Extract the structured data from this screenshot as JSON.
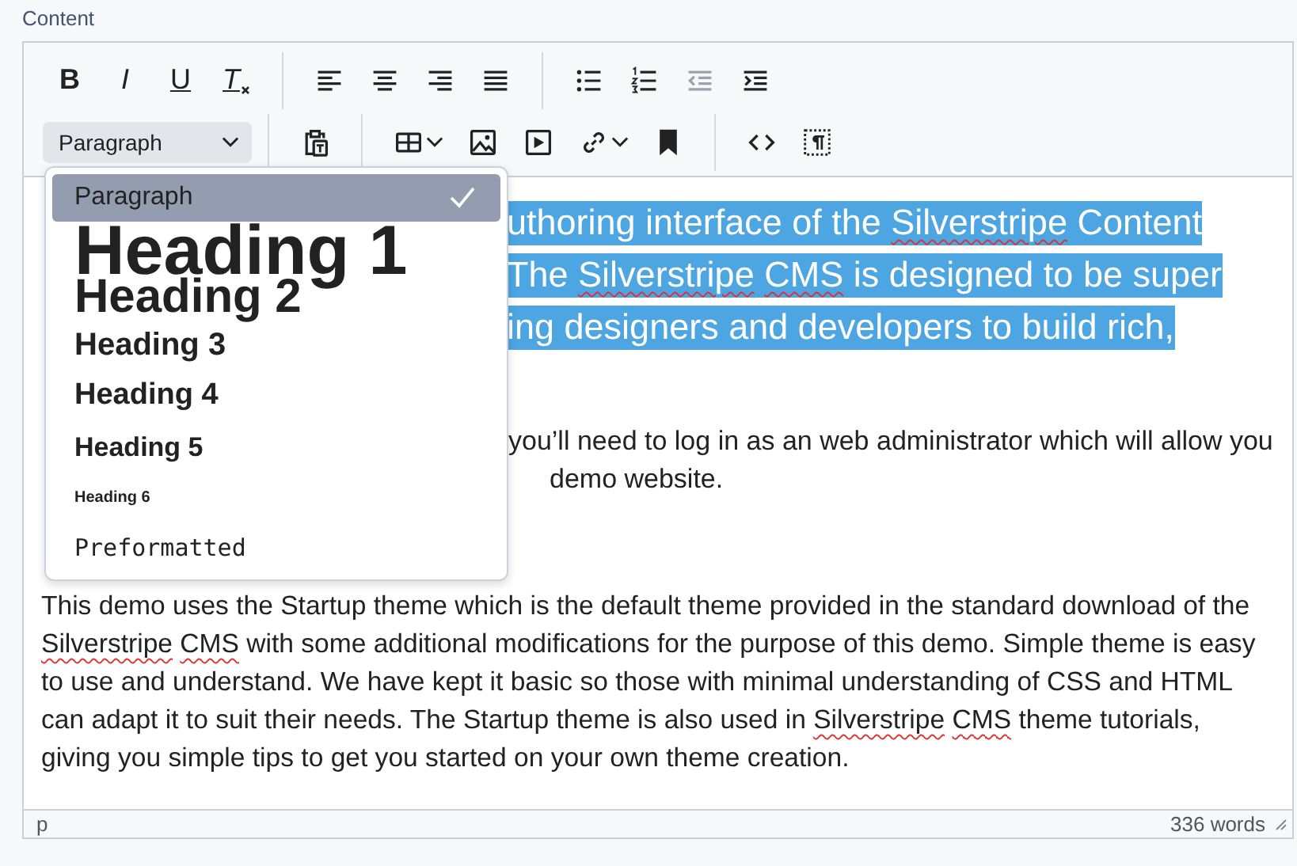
{
  "field_label": "Content",
  "toolbar": {
    "rows": [
      [
        {
          "buttons": [
            {
              "kind": "bold",
              "glyph": "B",
              "disabled": false,
              "has_menu": false
            },
            {
              "kind": "italic",
              "glyph": "I",
              "disabled": false,
              "has_menu": false
            },
            {
              "kind": "underline",
              "glyph": "U",
              "disabled": false,
              "has_menu": false
            },
            {
              "kind": "clear-format",
              "glyph": "T",
              "disabled": false,
              "has_menu": false
            }
          ]
        },
        {
          "buttons": [
            {
              "kind": "align-left",
              "disabled": false,
              "has_menu": false
            },
            {
              "kind": "align-center",
              "disabled": false,
              "has_menu": false
            },
            {
              "kind": "align-right",
              "disabled": false,
              "has_menu": false
            },
            {
              "kind": "align-justify",
              "disabled": false,
              "has_menu": false
            }
          ]
        },
        {
          "buttons": [
            {
              "kind": "bullet-list",
              "disabled": false,
              "has_menu": false
            },
            {
              "kind": "number-list",
              "disabled": false,
              "has_menu": false
            },
            {
              "kind": "outdent",
              "disabled": true,
              "has_menu": false
            },
            {
              "kind": "indent",
              "disabled": false,
              "has_menu": false
            }
          ]
        }
      ],
      [
        {
          "select": {
            "value": "Paragraph",
            "expanded": true
          }
        },
        {
          "buttons": [
            {
              "kind": "paste-text",
              "disabled": false,
              "has_menu": false
            }
          ]
        },
        {
          "buttons": [
            {
              "kind": "table",
              "disabled": false,
              "has_menu": true
            },
            {
              "kind": "image",
              "disabled": false,
              "has_menu": false
            },
            {
              "kind": "media",
              "disabled": false,
              "has_menu": false
            },
            {
              "kind": "link",
              "disabled": false,
              "has_menu": true
            },
            {
              "kind": "bookmark",
              "disabled": false,
              "has_menu": false
            }
          ]
        },
        {
          "buttons": [
            {
              "kind": "code",
              "disabled": false,
              "has_menu": false
            },
            {
              "kind": "visual-blocks",
              "disabled": false,
              "has_menu": false
            }
          ]
        }
      ]
    ]
  },
  "format_menu": [
    {
      "label": "Paragraph",
      "kind": "p",
      "selected": true
    },
    {
      "label": "Heading 1",
      "kind": "h1",
      "selected": false
    },
    {
      "label": "Heading 2",
      "kind": "h2",
      "selected": false
    },
    {
      "label": "Heading 3",
      "kind": "h3",
      "selected": false
    },
    {
      "label": "Heading 4",
      "kind": "h4",
      "selected": false
    },
    {
      "label": "Heading 5",
      "kind": "h5",
      "selected": false
    },
    {
      "label": "Heading 6",
      "kind": "h6",
      "selected": false
    },
    {
      "label": "Preformatted",
      "kind": "pre",
      "selected": false
    }
  ],
  "content": {
    "lead": {
      "selected": true,
      "lines": [
        [
          {
            "text": "uthoring interface of the ",
            "misspelled": false
          },
          {
            "text": "Silverstripe",
            "misspelled": true
          },
          {
            "text": " Content",
            "misspelled": false
          }
        ],
        [
          {
            "text": "The ",
            "misspelled": false
          },
          {
            "text": "Silverstripe ",
            "misspelled": true
          },
          {
            "text": "CMS",
            "misspelled": true
          },
          {
            "text": " is designed to be super",
            "misspelled": false
          }
        ],
        [
          {
            "text": "ing designers and developers to build rich,",
            "misspelled": false
          }
        ]
      ]
    },
    "intro_lines": [
      "you’ll need to log in as an web administrator which will allow you",
      "demo website."
    ],
    "body": [
      {
        "text": "This demo uses the Startup theme which is the default theme provided in the standard download of the ",
        "misspelled": false
      },
      {
        "text": "Silverstripe ",
        "misspelled": true
      },
      {
        "text": "CMS",
        "misspelled": true
      },
      {
        "text": " with some additional modifications for the purpose of this demo. Simple theme is easy to use and understand. We have kept it basic so those with minimal understanding of CSS and HTML can adapt it to suit their needs. The Startup theme is also used in ",
        "misspelled": false
      },
      {
        "text": "Silverstripe ",
        "misspelled": true
      },
      {
        "text": "CMS",
        "misspelled": true
      },
      {
        "text": " theme tutorials, giving you simple tips to get you started on your own theme creation.",
        "misspelled": false
      }
    ]
  },
  "status_bar": {
    "path": "p",
    "word_count": "336 words"
  }
}
